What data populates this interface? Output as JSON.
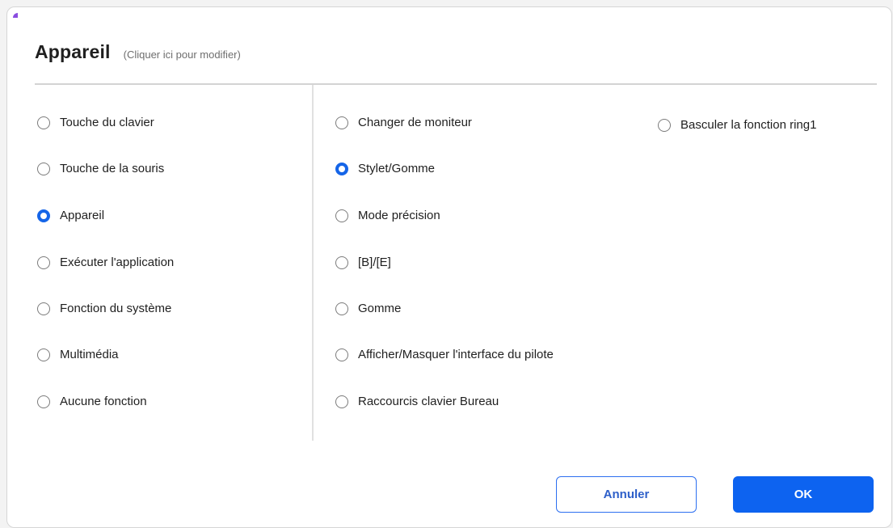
{
  "dialog": {
    "title": "Appareil",
    "subtitle": "(Cliquer ici pour modifier)"
  },
  "left_options": [
    {
      "label": "Touche du clavier",
      "checked": false
    },
    {
      "label": "Touche de la souris",
      "checked": false
    },
    {
      "label": "Appareil",
      "checked": true
    },
    {
      "label": "Exécuter l'application",
      "checked": false
    },
    {
      "label": "Fonction du système",
      "checked": false
    },
    {
      "label": "Multimédia",
      "checked": false
    },
    {
      "label": "Aucune fonction",
      "checked": false
    }
  ],
  "right_options_col1": [
    {
      "label": "Changer de moniteur",
      "checked": false
    },
    {
      "label": "Stylet/Gomme",
      "checked": true
    },
    {
      "label": "Mode précision",
      "checked": false
    },
    {
      "label": "[B]/[E]",
      "checked": false
    },
    {
      "label": "Gomme",
      "checked": false
    },
    {
      "label": "Afficher/Masquer l'interface du pilote",
      "checked": false
    },
    {
      "label": "Raccourcis clavier Bureau",
      "checked": false
    }
  ],
  "right_options_col2": [
    {
      "label": "Basculer la fonction ring1",
      "checked": false
    }
  ],
  "buttons": {
    "cancel": "Annuler",
    "ok": "OK"
  },
  "colors": {
    "accent": "#0d63f0",
    "radio_checked": "#1565e8"
  }
}
